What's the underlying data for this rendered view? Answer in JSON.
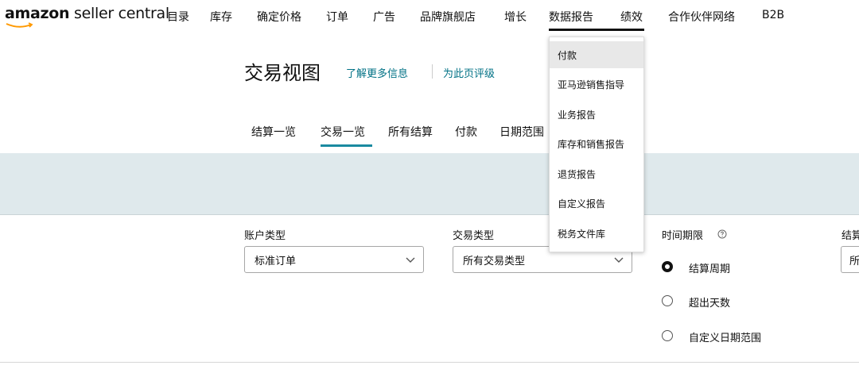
{
  "brand": {
    "amazon": "amazon",
    "seller_central": " seller central"
  },
  "nav": {
    "items": [
      "目录",
      "库存",
      "确定价格",
      "订单",
      "广告",
      "品牌旗舰店",
      "增长",
      "数据报告",
      "绩效",
      "合作伙伴网络",
      "B2B"
    ],
    "active": "数据报告"
  },
  "page": {
    "title": "交易视图",
    "learn_more": "了解更多信息",
    "rate_page": "为此页评级"
  },
  "tabs": {
    "items": [
      "结算一览",
      "交易一览",
      "所有结算",
      "付款",
      "日期范围"
    ],
    "active": "交易一览"
  },
  "filters": {
    "account_type": {
      "label": "账户类型",
      "value": "标准订单"
    },
    "transaction_type": {
      "label": "交易类型",
      "value": "所有交易类型"
    },
    "time_period": {
      "label": "时间期限",
      "help_icon": "help-circle-icon",
      "options": [
        "结算周期",
        "超出天数",
        "自定义日期范围"
      ],
      "selected": "结算周期"
    },
    "settlement": {
      "label": "结算",
      "value": "所"
    }
  },
  "reports_menu": {
    "items": [
      "付款",
      "亚马逊销售指导",
      "业务报告",
      "库存和销售报告",
      "退货报告",
      "自定义报告",
      "税务文件库"
    ],
    "highlighted": "付款"
  },
  "colors": {
    "link": "#007185",
    "band": "#dfe9ec",
    "smile": "#ff9900"
  }
}
